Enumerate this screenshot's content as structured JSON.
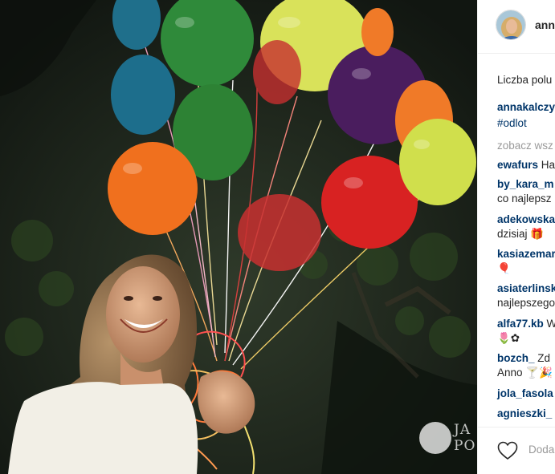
{
  "post": {
    "username": "annakalczy",
    "likes_label": "Liczba polu"
  },
  "watermark": {
    "line1": "JA",
    "line2": "PO"
  },
  "comments": [
    {
      "user": "annakalczy",
      "text": ""
    },
    {
      "user": "",
      "text": "#odlot",
      "style": "tag"
    },
    {
      "user": "",
      "text": "zobacz wsz",
      "style": "muted"
    },
    {
      "user": "ewafurs",
      "text": " Ha"
    },
    {
      "user": "by_kara_m",
      "text": ""
    },
    {
      "user": "",
      "text": "co najlepsz"
    },
    {
      "user": "adekowska",
      "text": ""
    },
    {
      "user": "",
      "text": "dzisiaj 🎁"
    },
    {
      "user": "kasiazemar",
      "text": ""
    },
    {
      "user": "",
      "text": "🎈"
    },
    {
      "user": "asiaterlinsk",
      "text": ""
    },
    {
      "user": "",
      "text": "najlepszego"
    },
    {
      "user": "alfa77.kb",
      "text": " W"
    },
    {
      "user": "",
      "text": "🌷✿"
    },
    {
      "user": "bozch_",
      "text": " Zd"
    },
    {
      "user": "",
      "text": "Anno 🍸🎉"
    },
    {
      "user": "jola_fasola",
      "text": ""
    },
    {
      "user": "agnieszki_",
      "text": ""
    }
  ],
  "footer": {
    "add_comment_placeholder": "Doda"
  },
  "icons": {
    "like": "heart-icon"
  },
  "colors": {
    "link": "#003569",
    "muted": "#999999",
    "text": "#262626",
    "divider": "#efefef"
  }
}
